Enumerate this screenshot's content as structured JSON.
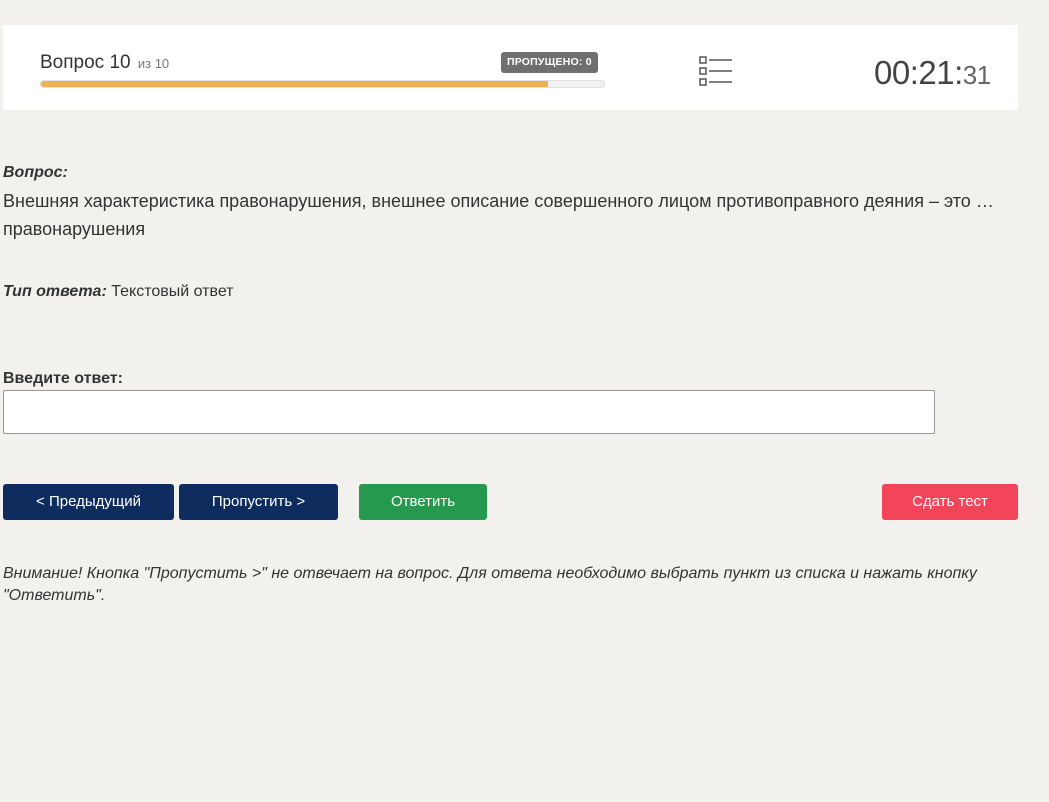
{
  "header": {
    "question_label": "Вопрос 10",
    "question_of": "из 10",
    "skipped_badge": "ПРОПУЩЕНО: 0",
    "progress_fraction": 0.9,
    "progress_color": "#eeb052",
    "list_icon": "list-icon",
    "timer_main": "00:21:",
    "timer_seconds": "31"
  },
  "question": {
    "label": "Вопрос:",
    "text": "Внешняя характеристика правонарушения, внешнее описание совершенного лицом противоправного деяния – это … правонарушения"
  },
  "answer_type": {
    "label": "Тип ответа:",
    "value": "Текстовый ответ"
  },
  "answer_input": {
    "label": "Введите ответ:",
    "value": "",
    "placeholder": ""
  },
  "buttons": {
    "prev": "< Предыдущий",
    "skip": "Пропустить >",
    "answer": "Ответить",
    "finish": "Сдать тест"
  },
  "colors": {
    "nav_buttons": "#0e2d5e",
    "answer_button": "#259a4f",
    "finish_button": "#f2455a",
    "badge": "#6f6f6f"
  },
  "note": "Внимание! Кнопка \"Пропустить >\" не отвечает на вопрос. Для ответа необходимо выбрать пункт из списка и нажать кнопку \"Ответить\"."
}
